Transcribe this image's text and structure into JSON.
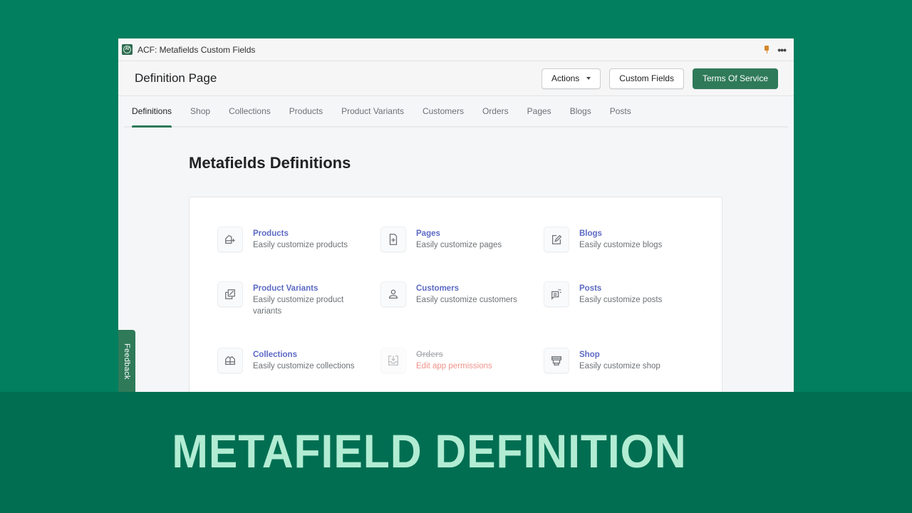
{
  "app": {
    "name": "ACF: Metafields Custom Fields",
    "logo_icon": "acf-logo",
    "pin_icon": "pin-icon",
    "more_icon": "more-horizontal-icon"
  },
  "header": {
    "title": "Definition Page",
    "actions_label": "Actions",
    "custom_fields_label": "Custom Fields",
    "terms_label": "Terms Of Service"
  },
  "tabs": [
    {
      "label": "Definitions",
      "active": true
    },
    {
      "label": "Shop"
    },
    {
      "label": "Collections"
    },
    {
      "label": "Products"
    },
    {
      "label": "Product Variants"
    },
    {
      "label": "Customers"
    },
    {
      "label": "Orders"
    },
    {
      "label": "Pages"
    },
    {
      "label": "Blogs"
    },
    {
      "label": "Posts"
    }
  ],
  "main": {
    "title": "Metafields Definitions",
    "items": [
      {
        "title": "Products",
        "desc": "Easily customize products",
        "icon": "product-icon"
      },
      {
        "title": "Pages",
        "desc": "Easily customize pages",
        "icon": "page-add-icon"
      },
      {
        "title": "Blogs",
        "desc": "Easily customize blogs",
        "icon": "edit-icon"
      },
      {
        "title": "Product Variants",
        "desc": "Easily customize product variants",
        "icon": "variants-icon"
      },
      {
        "title": "Customers",
        "desc": "Easily customize customers",
        "icon": "customer-icon"
      },
      {
        "title": "Posts",
        "desc": "Easily customize posts",
        "icon": "post-icon"
      },
      {
        "title": "Collections",
        "desc": "Easily customize collections",
        "icon": "collections-icon"
      },
      {
        "title": "Orders",
        "desc": "Edit app permissions",
        "icon": "orders-icon",
        "disabled": true
      },
      {
        "title": "Shop",
        "desc": "Easily customize shop",
        "icon": "store-icon"
      }
    ]
  },
  "feedback_label": "Feedback",
  "banner": {
    "text": "METAFIELD DEFINITION"
  },
  "colors": {
    "background": "#017f5e",
    "banner": "#016e52",
    "banner_text": "#b1ecd3",
    "primary": "#2f7a59",
    "link": "#5c6ac4",
    "error": "#f0928a"
  }
}
